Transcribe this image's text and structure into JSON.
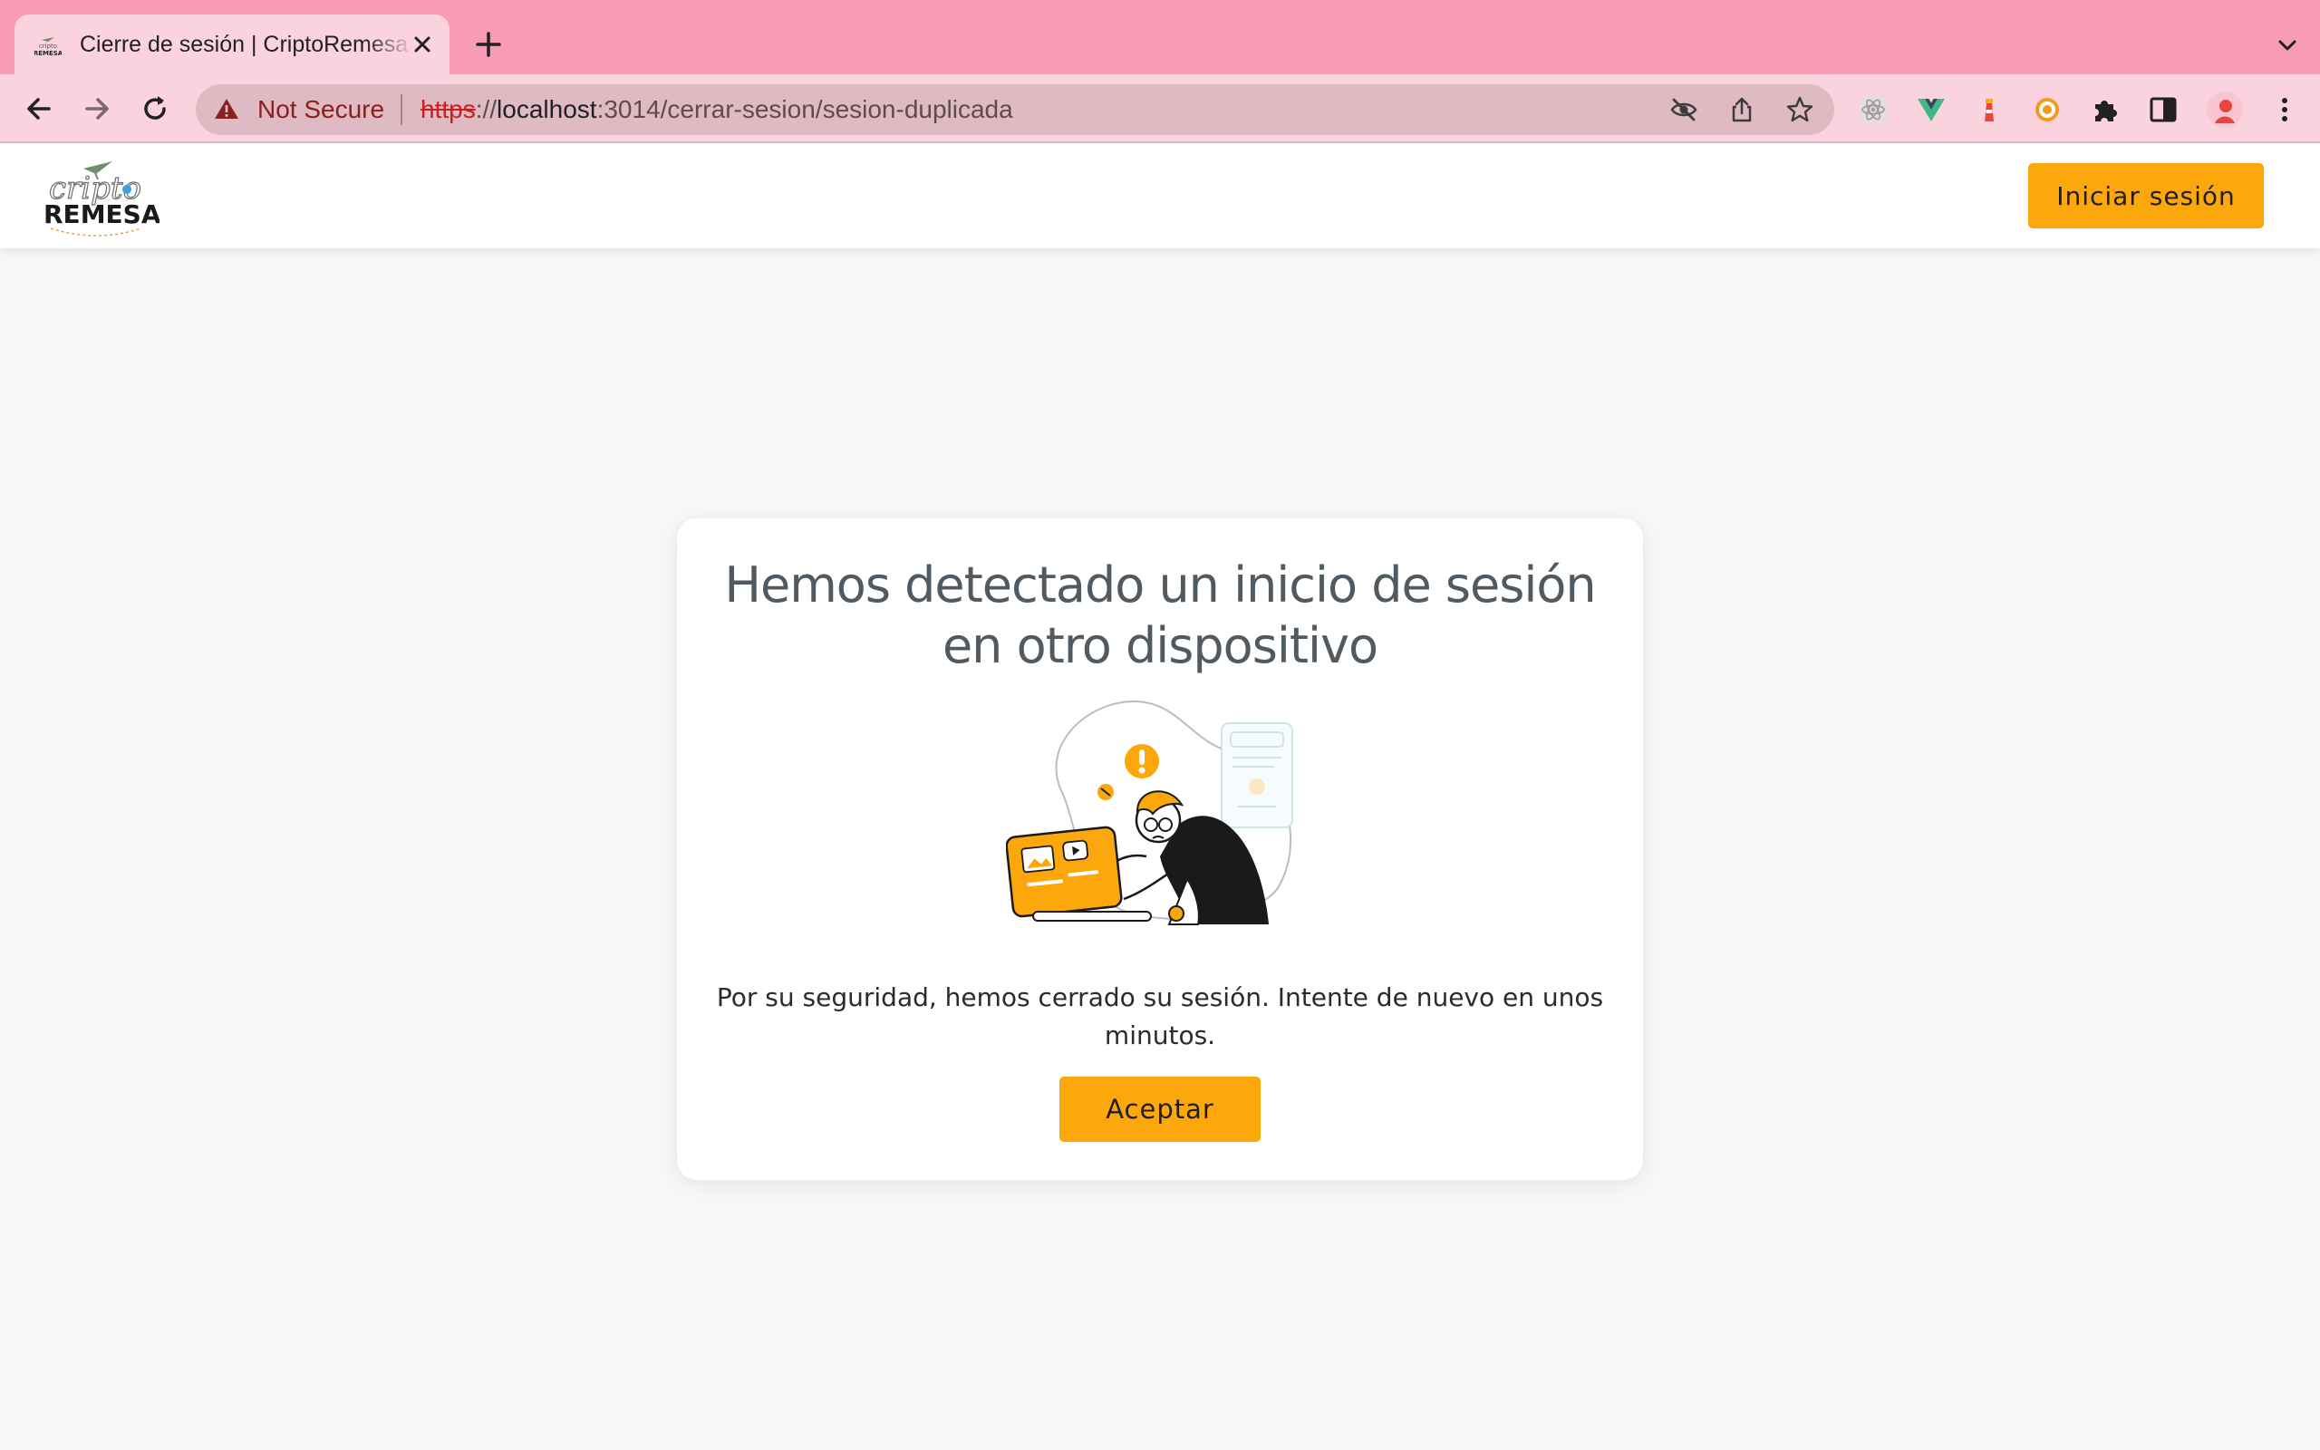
{
  "browser": {
    "tab": {
      "title": "Cierre de sesión | CriptoRemesa"
    },
    "address_bar": {
      "security_label": "Not Secure",
      "url_scheme": "https",
      "url_sep": "://",
      "url_host": "localhost",
      "url_rest": ":3014/cerrar-sesion/sesion-duplicada"
    }
  },
  "header": {
    "logo_text_top": "cripto",
    "logo_text_bottom": "REMESA",
    "login_button": "Iniciar sesión"
  },
  "card": {
    "title_line1": "Hemos detectado un inicio de sesión",
    "title_line2": "en otro dispositivo",
    "message_line1": "Por su seguridad, hemos cerrado su sesión. Intente de nuevo en unos",
    "message_line2": "minutos.",
    "accept_button": "Aceptar"
  },
  "colors": {
    "accent": "#fca70b",
    "tabstrip": "#f89cb5",
    "toolbar": "#fbd3de",
    "title_text": "#505a60"
  }
}
